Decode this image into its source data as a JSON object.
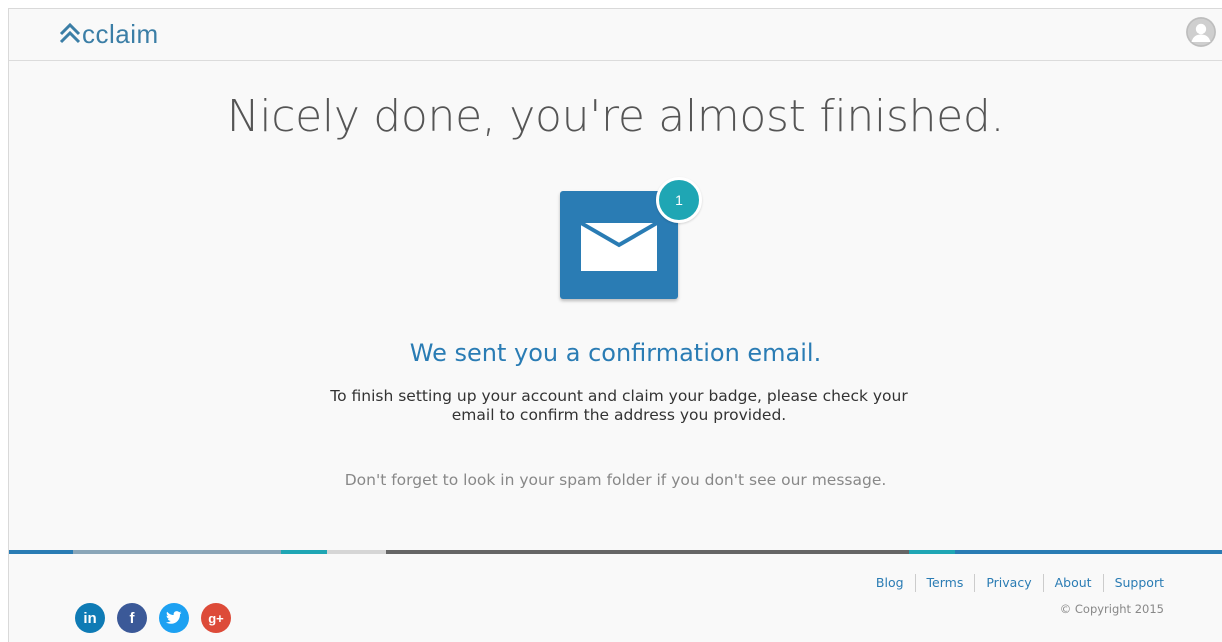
{
  "header": {
    "logo_text": "cclaim",
    "brand_color": "#3b7ea6"
  },
  "main": {
    "headline": "Nicely done, you're almost finished.",
    "mail_badge_count": "1",
    "sent_title": "We sent you a confirmation email.",
    "instructions_line1": "To finish setting up your account and claim your badge, please check your",
    "instructions_line2": "email to confirm the address you provided.",
    "spam_note": "Don't forget to look in your spam folder if you don't see our message."
  },
  "footer": {
    "social": [
      {
        "name": "linkedin-icon",
        "glyph": "in",
        "color": "#0f7bb5"
      },
      {
        "name": "facebook-icon",
        "glyph": "f",
        "color": "#3b5998"
      },
      {
        "name": "twitter-icon",
        "glyph": "t",
        "color": "#1da1f2"
      },
      {
        "name": "google-plus-icon",
        "glyph": "g+",
        "color": "#dd4b39"
      }
    ],
    "links": [
      "Blog",
      "Terms",
      "Privacy",
      "About",
      "Support"
    ],
    "copyright": "© Copyright 2015"
  },
  "colors": {
    "accent_blue": "#2a7cb4",
    "teal": "#1fa6b4",
    "band": [
      "#2a7cb4",
      "#8aa6b8",
      "#1fa6b4",
      "#d6d6d6",
      "#666666",
      "#1fa6b4",
      "#2a7cb4"
    ]
  }
}
